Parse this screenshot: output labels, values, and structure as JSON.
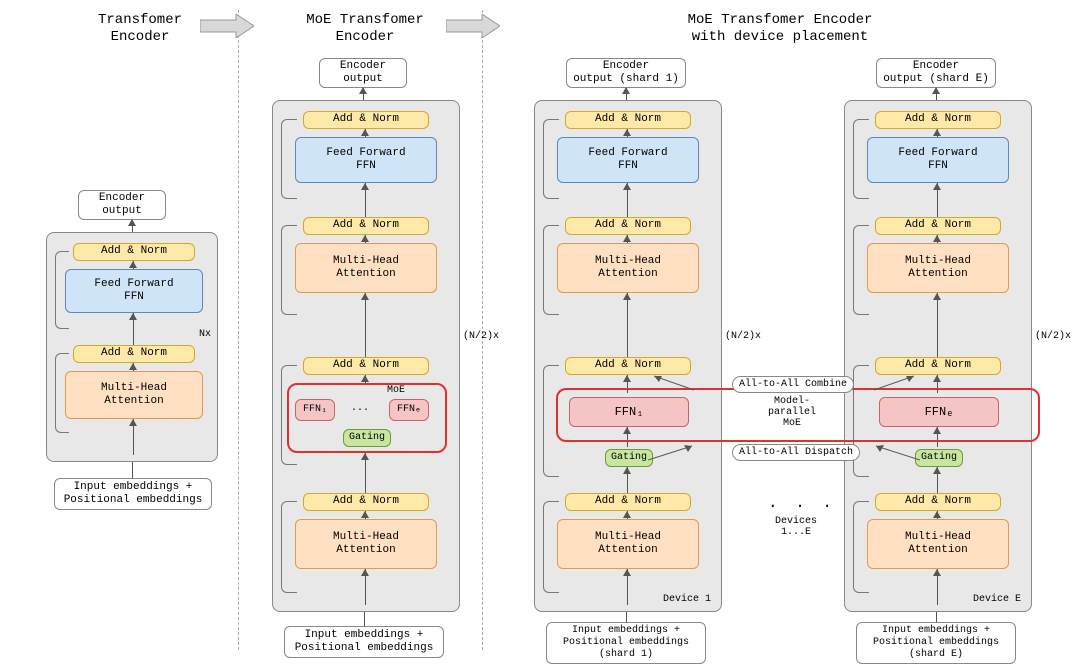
{
  "titles": {
    "t1": "Transfomer\nEncoder",
    "t2": "MoE Transfomer\nEncoder",
    "t3": "MoE Transfomer Encoder\nwith device placement"
  },
  "labels": {
    "encoder_output": "Encoder\noutput",
    "encoder_output_sh1": "Encoder\noutput (shard 1)",
    "encoder_output_shE": "Encoder\noutput (shard E)",
    "add_norm": "Add & Norm",
    "ffn": "Feed Forward\nFFN",
    "mha": "Multi-Head\nAttention",
    "nx": "Nx",
    "n2x": "(N/2)x",
    "moe": "MoE",
    "ffn1": "FFN₁",
    "ffnE": "FFNₑ",
    "ellipsis": "...",
    "gating": "Gating",
    "input": "Input embeddings +\nPositional embeddings",
    "input_sh1": "Input embeddings +\nPositional embeddings\n(shard 1)",
    "input_shE": "Input embeddings +\nPositional embeddings\n(shard E)",
    "all2all_combine": "All-to-All Combine",
    "all2all_dispatch": "All-to-All Dispatch",
    "mp_moe": "Model-parallel\nMoE",
    "device1": "Device 1",
    "deviceE": "Device E",
    "devices": "Devices\n1...E",
    "dots3": ". . ."
  }
}
